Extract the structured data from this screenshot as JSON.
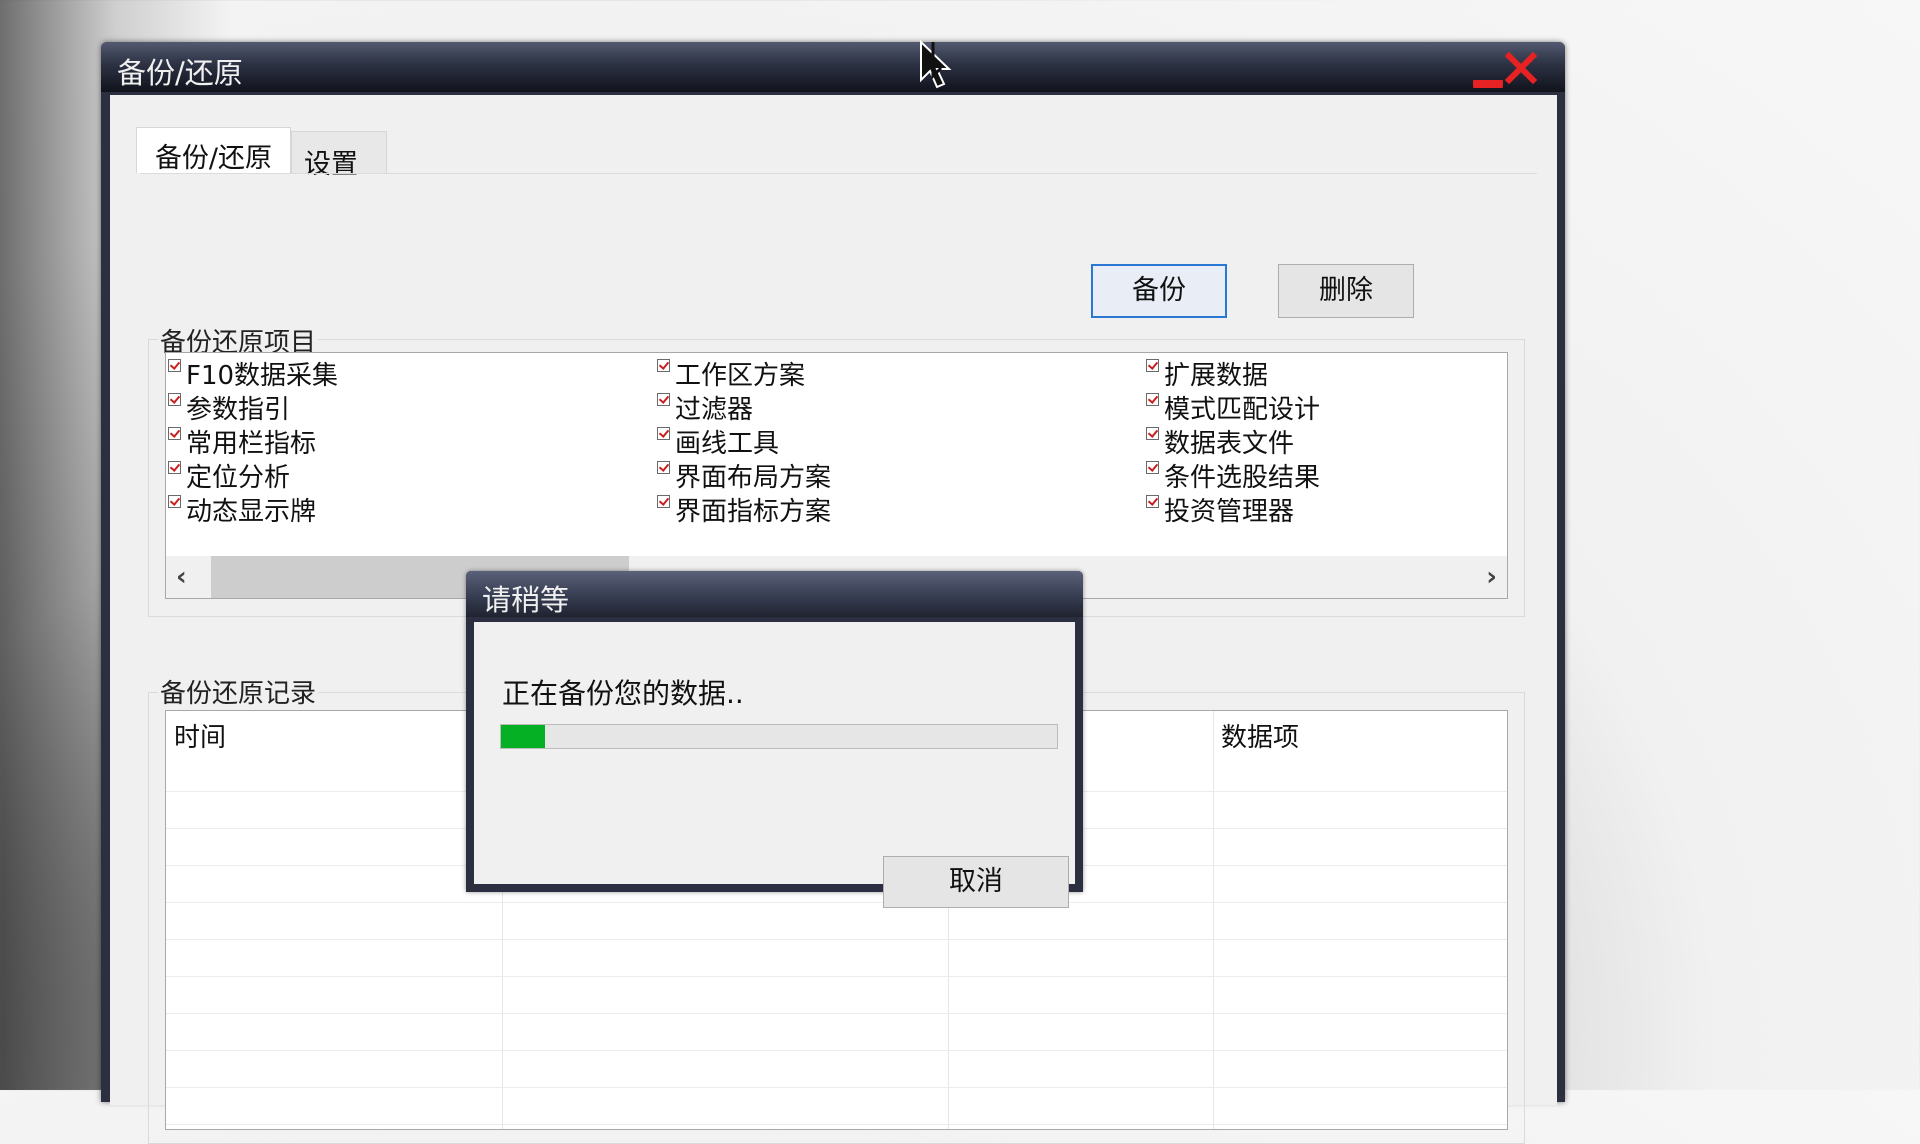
{
  "window": {
    "title": "备份/还原"
  },
  "tabs": [
    {
      "label": "备份/还原",
      "active": true
    },
    {
      "label": "设置",
      "active": false
    }
  ],
  "toolbar": {
    "backup_label": "备份",
    "delete_label": "删除"
  },
  "items_group": {
    "label": "备份还原项目",
    "columns": [
      [
        "F10数据采集",
        "参数指引",
        "常用栏指标",
        "定位分析",
        "动态显示牌"
      ],
      [
        "工作区方案",
        "过滤器",
        "画线工具",
        "界面布局方案",
        "界面指标方案"
      ],
      [
        "扩展数据",
        "模式匹配设计",
        "数据表文件",
        "条件选股结果",
        "投资管理器"
      ]
    ],
    "all_checked": true
  },
  "records_group": {
    "label": "备份还原记录",
    "headers": [
      "时间",
      "",
      "",
      "数据项"
    ]
  },
  "modal": {
    "title": "请稍等",
    "message": "正在备份您的数据..",
    "progress_fraction": 0.08,
    "cancel_label": "取消"
  },
  "colors": {
    "titlebar": "#2c3143",
    "progress": "#06b025",
    "check": "#c81e1e",
    "primary_border": "#2a78d4"
  }
}
